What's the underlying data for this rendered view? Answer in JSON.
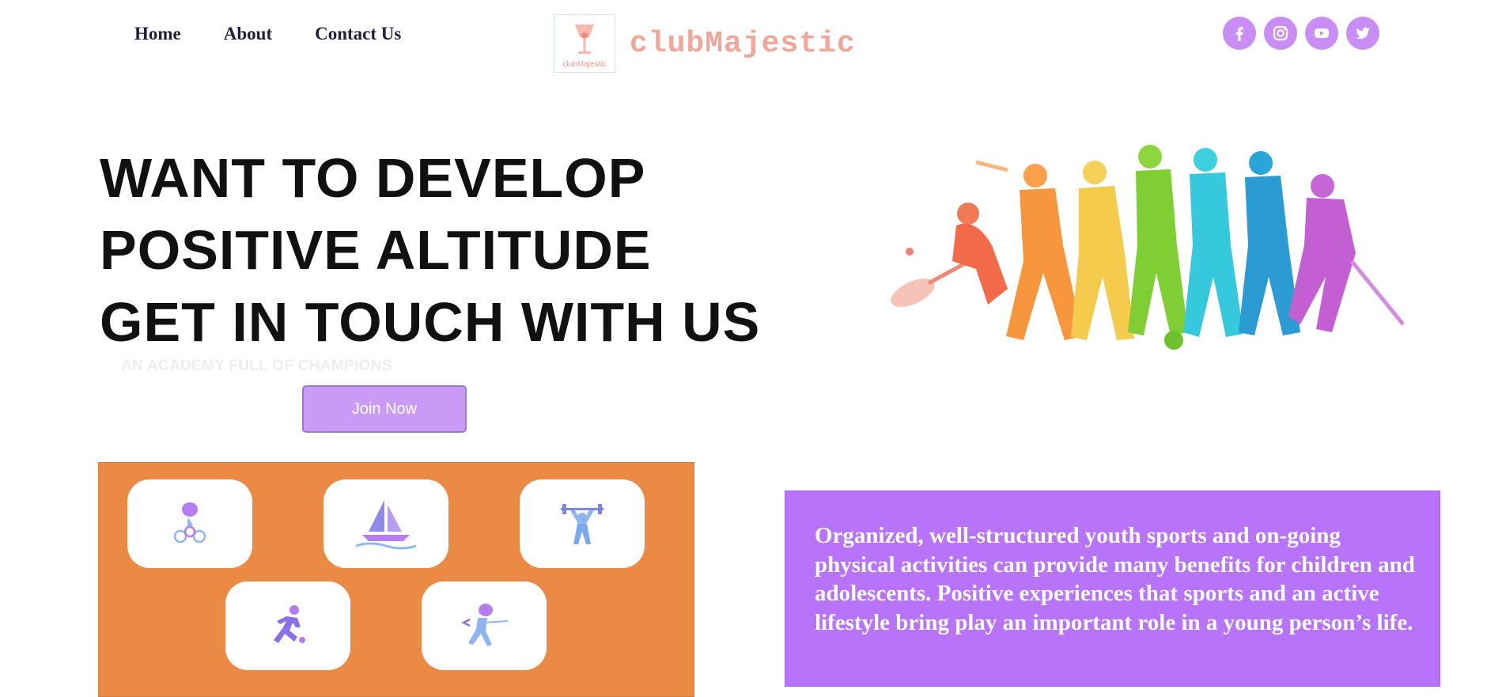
{
  "nav": {
    "items": [
      {
        "label": "Home"
      },
      {
        "label": "About"
      },
      {
        "label": "Contact Us"
      }
    ]
  },
  "brand": {
    "name": "clubMajestic",
    "logo_caption": "clubMajestic"
  },
  "social": {
    "icons": [
      "facebook-icon",
      "instagram-icon",
      "youtube-icon",
      "twitter-icon"
    ]
  },
  "hero": {
    "headline": [
      "WANT TO DEVELOP",
      "POSITIVE ALTITUDE",
      "GET IN TOUCH WITH US"
    ],
    "tagline": "AN ACADEMY FULL OF CHAMPIONS",
    "cta_label": "Join Now"
  },
  "sports": {
    "icons": [
      "cycling-icon",
      "sailing-icon",
      "weightlifting-icon",
      "running-icon",
      "fencing-icon"
    ]
  },
  "info": {
    "text": "Organized, well-structured youth sports and on-going physical activities can provide many benefits for children and adolescents. Positive experiences that sports and an active lifestyle bring play an important role in a young person’s life."
  },
  "colors": {
    "accent_purple": "#b873fb",
    "orange": "#ea8a45",
    "brand_text": "#f0a79a"
  }
}
